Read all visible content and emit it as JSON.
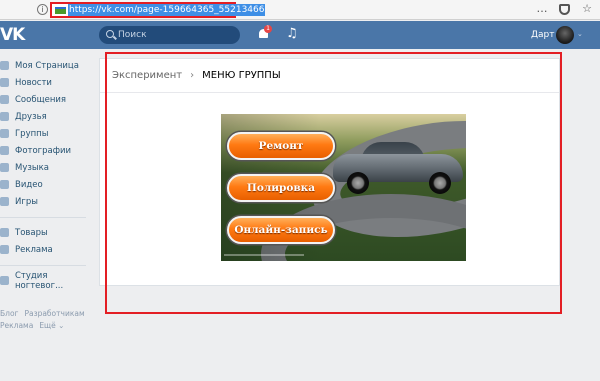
{
  "browser": {
    "url": "https://vk.com/page-159664365_55213466",
    "info_glyph": "i",
    "more_glyph": "…",
    "down_glyph": "⌄",
    "star_glyph": "☆"
  },
  "header": {
    "logo": "VK",
    "search_placeholder": "Поиск",
    "notif_count": "1",
    "music_glyph": "♫",
    "user_name": "Дарт",
    "caret": "⌄"
  },
  "sidebar": {
    "items": [
      {
        "label": "Моя Страница",
        "icon": "home-icon"
      },
      {
        "label": "Новости",
        "icon": "news-icon"
      },
      {
        "label": "Сообщения",
        "icon": "messages-icon"
      },
      {
        "label": "Друзья",
        "icon": "friends-icon"
      },
      {
        "label": "Группы",
        "icon": "groups-icon"
      },
      {
        "label": "Фотографии",
        "icon": "photos-icon"
      },
      {
        "label": "Музыка",
        "icon": "music-icon"
      },
      {
        "label": "Видео",
        "icon": "video-icon"
      },
      {
        "label": "Игры",
        "icon": "games-icon"
      }
    ],
    "items2": [
      {
        "label": "Товары",
        "icon": "market-icon"
      },
      {
        "label": "Реклама",
        "icon": "ads-icon"
      }
    ],
    "items3": [
      {
        "label": "Студия ногтевог...",
        "icon": "community-icon"
      }
    ],
    "footer": {
      "blog": "Блог",
      "developers": "Разработчикам",
      "ads": "Реклама",
      "more": "Ещё ⌄"
    }
  },
  "main": {
    "breadcrumb_parent": "Эксперимент",
    "breadcrumb_sep": "›",
    "breadcrumb_current": "МЕНЮ ГРУППЫ",
    "buttons": {
      "repair": "Ремонт",
      "polish": "Полировка",
      "online": "Онлайн-запись"
    }
  },
  "colors": {
    "vk_blue": "#4a76a8",
    "highlight_red": "#e31e24",
    "button_orange": "#ff7a12"
  }
}
